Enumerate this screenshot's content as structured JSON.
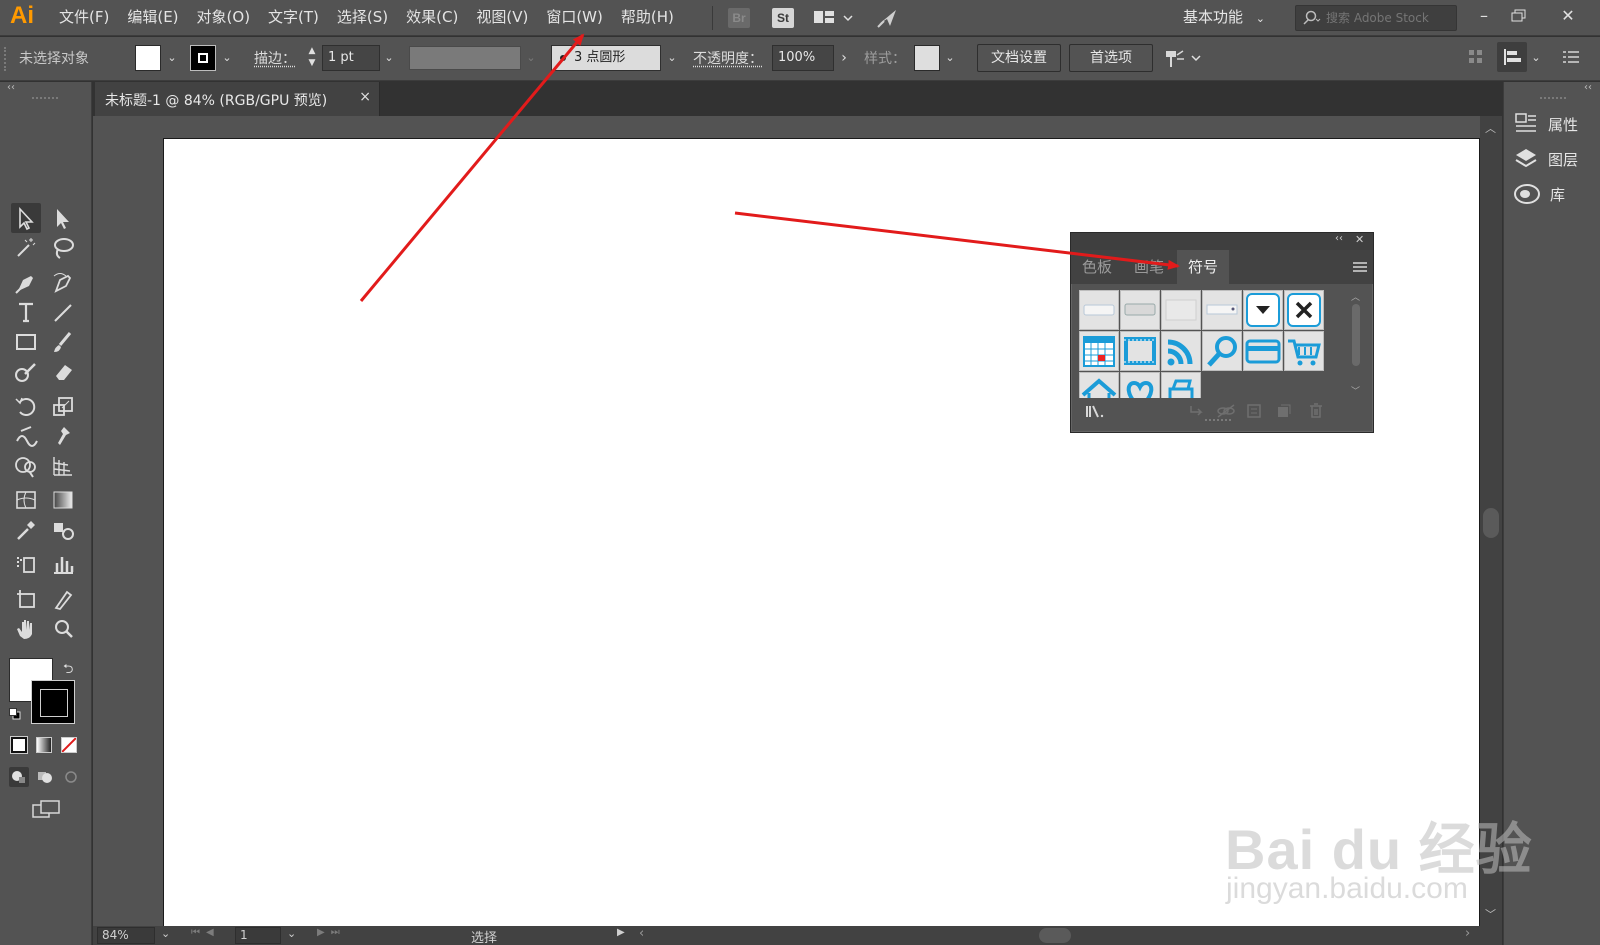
{
  "app": {
    "logo": "Ai"
  },
  "menubar": {
    "items": [
      "文件(F)",
      "编辑(E)",
      "对象(O)",
      "文字(T)",
      "选择(S)",
      "效果(C)",
      "视图(V)",
      "窗口(W)",
      "帮助(H)"
    ],
    "bridge_label": "Br",
    "stock_label": "St",
    "workspace": "基本功能",
    "search_placeholder": "搜索 Adobe Stock"
  },
  "control": {
    "selection_status": "未选择对象",
    "stroke_label": "描边：",
    "stroke_weight": "1 pt",
    "brush_label": "3 点圆形",
    "opacity_label": "不透明度：",
    "opacity_value": "100%",
    "style_label": "样式：",
    "doc_setup_button": "文档设置",
    "prefs_button": "首选项"
  },
  "document_tab": {
    "title": "未标题-1 @ 84% (RGB/GPU 预览)",
    "close": "×"
  },
  "right_dock": {
    "items": [
      {
        "label": "属性",
        "icon": "properties-icon"
      },
      {
        "label": "图层",
        "icon": "layers-icon"
      },
      {
        "label": "库",
        "icon": "libraries-icon"
      }
    ]
  },
  "symbols_panel": {
    "tabs": [
      "色板",
      "画笔",
      "符号"
    ],
    "active_tab": "符号",
    "symbols": [
      "web-button-1",
      "web-button-2",
      "web-button-3",
      "web-button-4",
      "dropdown-arrow",
      "close-x",
      "calendar",
      "film-frame",
      "rss-feed",
      "search-magnifier",
      "credit-card",
      "shopping-cart",
      "home",
      "heart",
      "printer"
    ]
  },
  "status": {
    "zoom": "84%",
    "artboard_number": "1",
    "tool_mode": "选择"
  },
  "watermark": {
    "brand": "Bai du 经验",
    "url": "jingyan.baidu.com"
  },
  "colors": {
    "accent": "#ff9a00",
    "symbol_blue": "#1b9cd8",
    "arrow_red": "#e21b1b"
  }
}
